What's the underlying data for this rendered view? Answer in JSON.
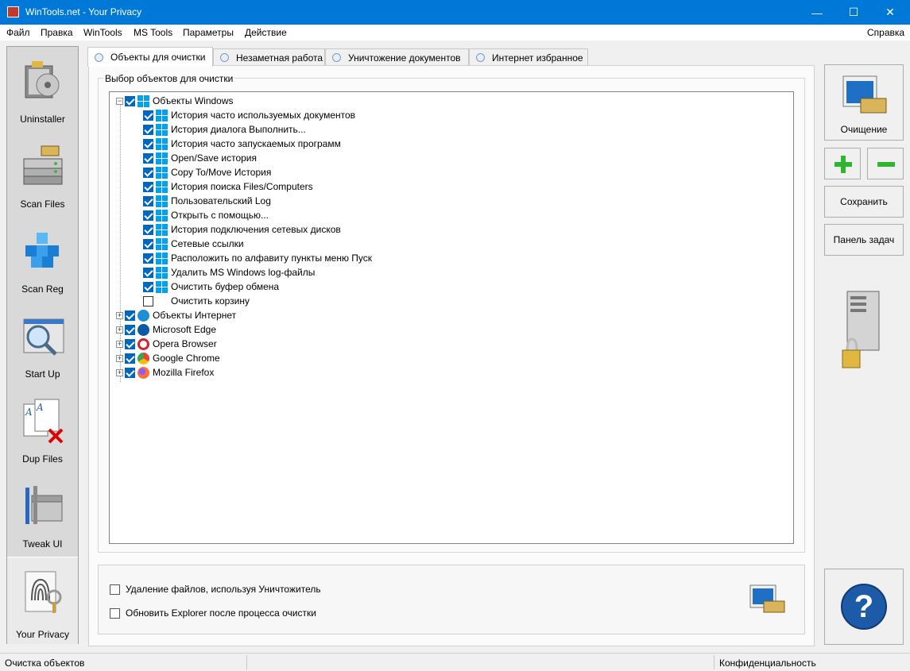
{
  "window": {
    "title": "WinTools.net - Your Privacy"
  },
  "menu": {
    "items": [
      "Файл",
      "Правка",
      "WinTools",
      "MS Tools",
      "Параметры",
      "Действие"
    ],
    "help": "Справка"
  },
  "sidebar": {
    "items": [
      {
        "label": "Uninstaller",
        "icon": "uninstaller-icon"
      },
      {
        "label": "Scan Files",
        "icon": "scan-files-icon"
      },
      {
        "label": "Scan Reg",
        "icon": "scan-reg-icon"
      },
      {
        "label": "Start Up",
        "icon": "startup-icon"
      },
      {
        "label": "Dup Files",
        "icon": "dup-files-icon"
      },
      {
        "label": "Tweak UI",
        "icon": "tweak-ui-icon"
      },
      {
        "label": "Your Privacy",
        "icon": "privacy-icon"
      }
    ]
  },
  "tabs": [
    "Объекты для очистки",
    "Незаметная работа",
    "Уничтожение документов",
    "Интернет избранное"
  ],
  "group": {
    "title": "Выбор объектов для очистки"
  },
  "tree": {
    "root": "Объекты Windows",
    "children": [
      {
        "label": "История часто используемых документов",
        "checked": true
      },
      {
        "label": "История диалога Выполнить...",
        "checked": true
      },
      {
        "label": "История часто запускаемых программ",
        "checked": true
      },
      {
        "label": "Open/Save история",
        "checked": true
      },
      {
        "label": "Copy To/Move История",
        "checked": true
      },
      {
        "label": "История поиска Files/Computers",
        "checked": true
      },
      {
        "label": "Пользовательский Log",
        "checked": true
      },
      {
        "label": "Открыть с помощью...",
        "checked": true
      },
      {
        "label": "История подключения сетевых дисков",
        "checked": true
      },
      {
        "label": "Сетевые ссылки",
        "checked": true
      },
      {
        "label": "Расположить по алфавиту пункты меню Пуск",
        "checked": true
      },
      {
        "label": "Удалить MS Windows log-файлы",
        "checked": true
      },
      {
        "label": "Очистить буфер обмена",
        "checked": true
      },
      {
        "label": "Очистить корзину",
        "checked": false
      }
    ],
    "groups": [
      {
        "label": "Объекты Интернет",
        "icon": "internet-explorer-icon",
        "color": "#1e8fd6"
      },
      {
        "label": "Microsoft Edge",
        "icon": "edge-icon",
        "color": "#0c59a4"
      },
      {
        "label": "Opera Browser",
        "icon": "opera-icon",
        "color": "#d6232f"
      },
      {
        "label": "Google Chrome",
        "icon": "chrome-icon",
        "color": "#34a853"
      },
      {
        "label": "Mozilla Firefox",
        "icon": "firefox-icon",
        "color": "#ff7139"
      }
    ]
  },
  "options": {
    "shred": "Удаление файлов, используя Уничтожитель",
    "refresh": "Обновить Explorer после процесса очистки"
  },
  "buttons": {
    "clean": "Очищение",
    "save": "Сохранить",
    "taskbar": "Панель задач",
    "help": "?"
  },
  "status": {
    "left": "Очистка объектов",
    "right": "Конфиденциальность"
  }
}
